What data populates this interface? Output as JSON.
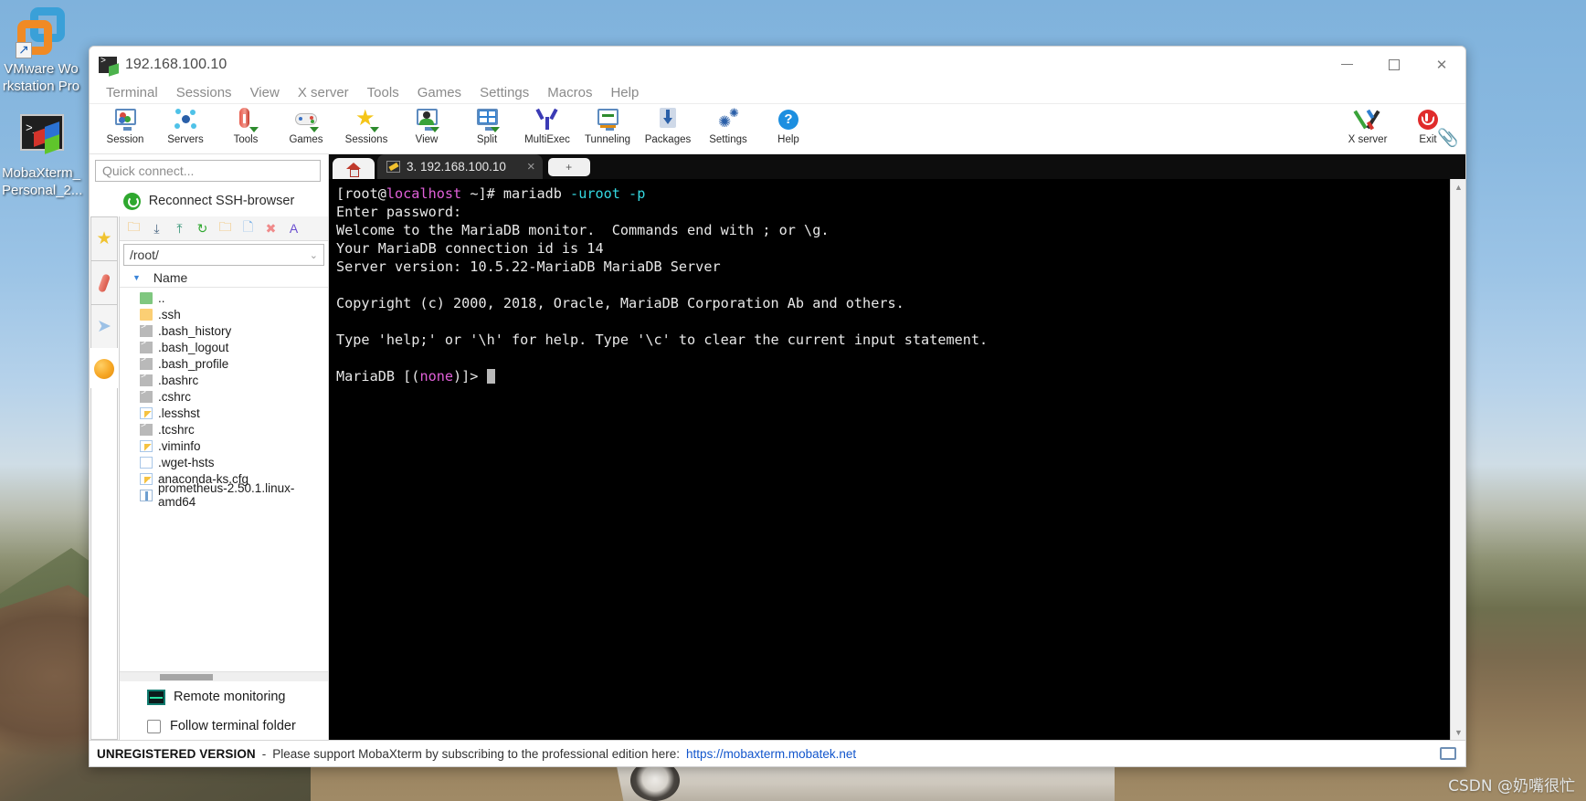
{
  "desktop": {
    "icons": [
      {
        "name": "vmware-workstation-pro",
        "label": "VMware Wo rkstation Pro"
      },
      {
        "name": "mobaxterm-personal",
        "label": "MobaXterm_ Personal_2..."
      }
    ],
    "watermark": "CSDN @奶嘴很忙"
  },
  "window": {
    "title": "192.168.100.10",
    "controls": {
      "minimize": "minimize-button",
      "maximize": "maximize-button",
      "close": "close-button"
    }
  },
  "menubar": {
    "items": [
      "Terminal",
      "Sessions",
      "View",
      "X server",
      "Tools",
      "Games",
      "Settings",
      "Macros",
      "Help"
    ]
  },
  "toolbar": {
    "items": [
      {
        "label": "Session",
        "icon": "session-icon"
      },
      {
        "label": "Servers",
        "icon": "servers-icon"
      },
      {
        "label": "Tools",
        "icon": "tools-icon"
      },
      {
        "label": "Games",
        "icon": "games-icon"
      },
      {
        "label": "Sessions",
        "icon": "sessions-star-icon"
      },
      {
        "label": "View",
        "icon": "view-icon"
      },
      {
        "label": "Split",
        "icon": "split-icon"
      },
      {
        "label": "MultiExec",
        "icon": "multiexec-icon"
      },
      {
        "label": "Tunneling",
        "icon": "tunneling-icon"
      },
      {
        "label": "Packages",
        "icon": "packages-icon"
      },
      {
        "label": "Settings",
        "icon": "settings-gear-icon"
      },
      {
        "label": "Help",
        "icon": "help-icon"
      }
    ],
    "right_items": [
      {
        "label": "X server",
        "icon": "x-server-icon"
      },
      {
        "label": "Exit",
        "icon": "exit-power-icon"
      }
    ]
  },
  "sidebar": {
    "quick_connect_placeholder": "Quick connect...",
    "reconnect_label": "Reconnect SSH-browser",
    "rail_buttons": [
      {
        "name": "favorites-star-icon",
        "glyph": "★"
      },
      {
        "name": "tools-knife-icon",
        "glyph": "🔪"
      },
      {
        "name": "send-plane-icon",
        "glyph": "➤"
      }
    ],
    "rail_globe": "globe-icon",
    "file_toolbar": [
      {
        "name": "folder-up-icon",
        "glyph": "↰"
      },
      {
        "name": "download-icon",
        "glyph": "↓"
      },
      {
        "name": "upload-icon",
        "glyph": "↑"
      },
      {
        "name": "refresh-icon",
        "glyph": "↻"
      },
      {
        "name": "new-folder-icon",
        "glyph": "🗀"
      },
      {
        "name": "new-file-icon",
        "glyph": "🗋"
      },
      {
        "name": "delete-icon",
        "glyph": "✕"
      },
      {
        "name": "text-mode-icon",
        "glyph": "A"
      }
    ],
    "path": "/root/",
    "column_header": "Name",
    "files": [
      {
        "name": "..",
        "icon": "folder-up"
      },
      {
        "name": ".ssh",
        "icon": "folder"
      },
      {
        "name": ".bash_history",
        "icon": "script"
      },
      {
        "name": ".bash_logout",
        "icon": "script"
      },
      {
        "name": ".bash_profile",
        "icon": "script"
      },
      {
        "name": ".bashrc",
        "icon": "script"
      },
      {
        "name": ".cshrc",
        "icon": "script"
      },
      {
        "name": ".lesshst",
        "icon": "doc-pen"
      },
      {
        "name": ".tcshrc",
        "icon": "script"
      },
      {
        "name": ".viminfo",
        "icon": "doc-pen"
      },
      {
        "name": ".wget-hsts",
        "icon": "doc"
      },
      {
        "name": "anaconda-ks.cfg",
        "icon": "doc-pen"
      },
      {
        "name": "prometheus-2.50.1.linux-amd64",
        "icon": "archive"
      }
    ],
    "remote_monitoring_label": "Remote monitoring",
    "follow_terminal_label": "Follow terminal folder",
    "follow_terminal_checked": false
  },
  "tabs": {
    "home_button": "home-tab-button",
    "active_tab": {
      "label": "3. 192.168.100.10",
      "close": "×"
    },
    "new_tab": "+",
    "clip_button": "clipboard-icon"
  },
  "terminal": {
    "lines": [
      [
        {
          "t": "[root@",
          "c": "white"
        },
        {
          "t": "localhost",
          "c": "magenta"
        },
        {
          "t": " ~]# mariadb ",
          "c": "white"
        },
        {
          "t": "-uroot -p",
          "c": "cyan"
        }
      ],
      [
        {
          "t": "Enter password:",
          "c": "white"
        }
      ],
      [
        {
          "t": "Welcome to the MariaDB monitor.  Commands end with ; or \\g.",
          "c": "white"
        }
      ],
      [
        {
          "t": "Your MariaDB connection id is 14",
          "c": "white"
        }
      ],
      [
        {
          "t": "Server version: 10.5.22-MariaDB MariaDB Server",
          "c": "white"
        }
      ],
      [
        {
          "t": "",
          "c": "white"
        }
      ],
      [
        {
          "t": "Copyright (c) 2000, 2018, Oracle, MariaDB Corporation Ab and others.",
          "c": "white"
        }
      ],
      [
        {
          "t": "",
          "c": "white"
        }
      ],
      [
        {
          "t": "Type 'help;' or '\\h' for help. Type '\\c' to clear the current input statement.",
          "c": "white"
        }
      ],
      [
        {
          "t": "",
          "c": "white"
        }
      ],
      [
        {
          "t": "MariaDB [(",
          "c": "white"
        },
        {
          "t": "none",
          "c": "magenta"
        },
        {
          "t": ")]> ",
          "c": "white"
        }
      ]
    ],
    "scrollbar": {
      "up": "▲",
      "down": "▼"
    }
  },
  "statusbar": {
    "unregistered": "UNREGISTERED VERSION",
    "dash": "-",
    "message": "Please support MobaXterm by subscribing to the professional edition here:",
    "link": "https://mobaxterm.mobatek.net",
    "monitor_icon": "display-status-icon"
  },
  "colors": {
    "accent_blue": "#3a84d8",
    "link_blue": "#1155cc",
    "terminal_bg": "#000000",
    "terminal_fg": "#d6d6d6",
    "magenta": "#e060d8",
    "cyan": "#34d8e0",
    "exit_red": "#e02b2b"
  }
}
